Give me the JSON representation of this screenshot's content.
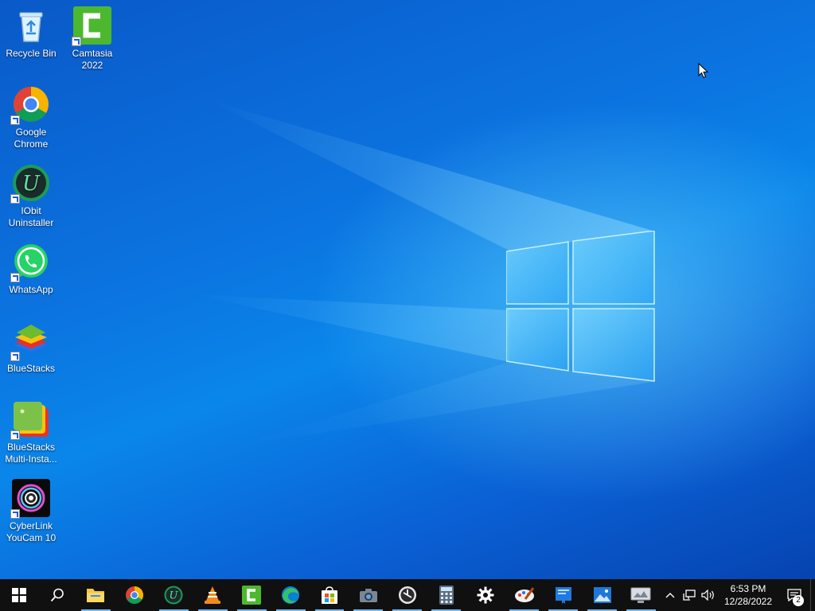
{
  "desktop": {
    "icons": [
      {
        "label": "Recycle Bin",
        "icon": "recycle-bin-icon"
      },
      {
        "label": "Camtasia 2022",
        "icon": "camtasia-icon"
      },
      {
        "label": "Google Chrome",
        "icon": "chrome-icon"
      },
      {
        "label": "IObit Uninstaller",
        "icon": "iobit-uninstaller-icon"
      },
      {
        "label": "WhatsApp",
        "icon": "whatsapp-icon"
      },
      {
        "label": "BlueStacks",
        "icon": "bluestacks-icon"
      },
      {
        "label": "BlueStacks Multi-Insta...",
        "icon": "bluestacks-multi-instance-icon"
      },
      {
        "label": "CyberLink YouCam 10",
        "icon": "youcam-icon"
      }
    ]
  },
  "taskbar": {
    "apps": [
      {
        "icon": "file-explorer-icon",
        "running": true
      },
      {
        "icon": "chrome-icon",
        "running": false
      },
      {
        "icon": "iobit-uninstaller-icon",
        "running": true
      },
      {
        "icon": "vlc-icon",
        "running": true
      },
      {
        "icon": "camtasia-icon",
        "running": true
      },
      {
        "icon": "edge-icon",
        "running": true
      },
      {
        "icon": "microsoft-store-icon",
        "running": true
      },
      {
        "icon": "camera-icon",
        "running": true
      },
      {
        "icon": "clock-app-icon",
        "running": true
      },
      {
        "icon": "calculator-icon",
        "running": true
      },
      {
        "icon": "settings-gear-icon",
        "running": false
      },
      {
        "icon": "paint-icon",
        "running": true
      },
      {
        "icon": "book-app-icon",
        "running": true
      },
      {
        "icon": "photos-icon",
        "running": true
      },
      {
        "icon": "display-app-icon",
        "running": true
      }
    ],
    "tray": {
      "time": "6:53 PM",
      "date": "12/28/2022",
      "notification_count": "2"
    }
  },
  "colors": {
    "taskbar_bg": "#101010",
    "running_indicator": "#76b9ed"
  }
}
